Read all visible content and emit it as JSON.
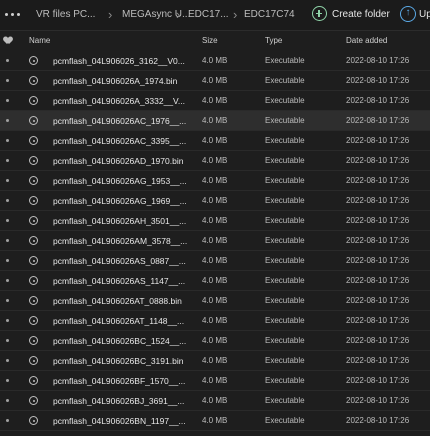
{
  "breadcrumb": [
    {
      "label": "VR files PC..."
    },
    {
      "label": "MEGAsync U..."
    },
    {
      "label": "EDC17..."
    },
    {
      "label": "EDC17C74"
    }
  ],
  "toolbar": {
    "create_folder_label": "Create folder",
    "upload_label": "Up"
  },
  "columns": {
    "name": "Name",
    "size": "Size",
    "type": "Type",
    "date": "Date added"
  },
  "files": [
    {
      "name": "pcmflash_04L906026_3162__V0...",
      "size": "4.0 MB",
      "type": "Executable",
      "date": "2022-08-10 17:26"
    },
    {
      "name": "pcmflash_04L906026A_1974.bin",
      "size": "4.0 MB",
      "type": "Executable",
      "date": "2022-08-10 17:26"
    },
    {
      "name": "pcmflash_04L906026A_3332__V...",
      "size": "4.0 MB",
      "type": "Executable",
      "date": "2022-08-10 17:26"
    },
    {
      "name": "pcmflash_04L906026AC_1976__...",
      "size": "4.0 MB",
      "type": "Executable",
      "date": "2022-08-10 17:26"
    },
    {
      "name": "pcmflash_04L906026AC_3395__...",
      "size": "4.0 MB",
      "type": "Executable",
      "date": "2022-08-10 17:26"
    },
    {
      "name": "pcmflash_04L906026AD_1970.bin",
      "size": "4.0 MB",
      "type": "Executable",
      "date": "2022-08-10 17:26"
    },
    {
      "name": "pcmflash_04L906026AG_1953__...",
      "size": "4.0 MB",
      "type": "Executable",
      "date": "2022-08-10 17:26"
    },
    {
      "name": "pcmflash_04L906026AG_1969__...",
      "size": "4.0 MB",
      "type": "Executable",
      "date": "2022-08-10 17:26"
    },
    {
      "name": "pcmflash_04L906026AH_3501__...",
      "size": "4.0 MB",
      "type": "Executable",
      "date": "2022-08-10 17:26"
    },
    {
      "name": "pcmflash_04L906026AM_3578__...",
      "size": "4.0 MB",
      "type": "Executable",
      "date": "2022-08-10 17:26"
    },
    {
      "name": "pcmflash_04L906026AS_0887__...",
      "size": "4.0 MB",
      "type": "Executable",
      "date": "2022-08-10 17:26"
    },
    {
      "name": "pcmflash_04L906026AS_1147__...",
      "size": "4.0 MB",
      "type": "Executable",
      "date": "2022-08-10 17:26"
    },
    {
      "name": "pcmflash_04L906026AT_0888.bin",
      "size": "4.0 MB",
      "type": "Executable",
      "date": "2022-08-10 17:26"
    },
    {
      "name": "pcmflash_04L906026AT_1148__...",
      "size": "4.0 MB",
      "type": "Executable",
      "date": "2022-08-10 17:26"
    },
    {
      "name": "pcmflash_04L906026BC_1524__...",
      "size": "4.0 MB",
      "type": "Executable",
      "date": "2022-08-10 17:26"
    },
    {
      "name": "pcmflash_04L906026BC_3191.bin",
      "size": "4.0 MB",
      "type": "Executable",
      "date": "2022-08-10 17:26"
    },
    {
      "name": "pcmflash_04L906026BF_1570__...",
      "size": "4.0 MB",
      "type": "Executable",
      "date": "2022-08-10 17:26"
    },
    {
      "name": "pcmflash_04L906026BJ_3691__...",
      "size": "4.0 MB",
      "type": "Executable",
      "date": "2022-08-10 17:26"
    },
    {
      "name": "pcmflash_04L906026BN_1197__...",
      "size": "4.0 MB",
      "type": "Executable",
      "date": "2022-08-10 17:26"
    }
  ]
}
